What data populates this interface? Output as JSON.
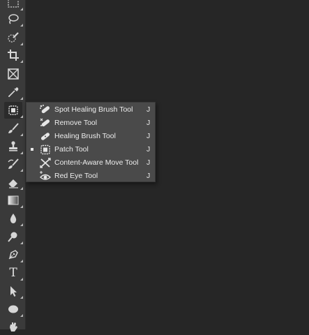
{
  "toolbar": {
    "tools": [
      {
        "name": "rectangular-marquee-tool",
        "icon": "marquee-icon"
      },
      {
        "name": "lasso-tool",
        "icon": "lasso-icon"
      },
      {
        "name": "quick-selection-tool",
        "icon": "quick-selection-icon"
      },
      {
        "name": "crop-tool",
        "icon": "crop-icon"
      },
      {
        "name": "frame-tool",
        "icon": "frame-icon"
      },
      {
        "name": "eyedropper-tool",
        "icon": "eyedropper-icon"
      },
      {
        "name": "patch-tool",
        "icon": "patch-icon",
        "active": true
      },
      {
        "name": "brush-tool",
        "icon": "brush-icon"
      },
      {
        "name": "clone-stamp-tool",
        "icon": "stamp-icon"
      },
      {
        "name": "history-brush-tool",
        "icon": "history-brush-icon"
      },
      {
        "name": "eraser-tool",
        "icon": "eraser-icon"
      },
      {
        "name": "gradient-tool",
        "icon": "gradient-icon"
      },
      {
        "name": "blur-tool",
        "icon": "blur-drop-icon"
      },
      {
        "name": "dodge-tool",
        "icon": "dodge-icon"
      },
      {
        "name": "pen-tool",
        "icon": "pen-icon"
      },
      {
        "name": "type-tool",
        "icon": "type-icon",
        "glyph": "T"
      },
      {
        "name": "path-selection-tool",
        "icon": "arrow-icon"
      },
      {
        "name": "ellipse-tool",
        "icon": "ellipse-icon"
      },
      {
        "name": "hand-tool",
        "icon": "hand-icon"
      }
    ]
  },
  "flyout": {
    "items": [
      {
        "label": "Spot Healing Brush Tool",
        "shortcut": "J",
        "icon": "spot-healing-brush-icon",
        "selected": false
      },
      {
        "label": "Remove Tool",
        "shortcut": "J",
        "icon": "remove-tool-icon",
        "selected": false
      },
      {
        "label": "Healing Brush Tool",
        "shortcut": "J",
        "icon": "healing-brush-icon",
        "selected": false
      },
      {
        "label": "Patch Tool",
        "shortcut": "J",
        "icon": "patch-icon",
        "selected": true
      },
      {
        "label": "Content-Aware Move Tool",
        "shortcut": "J",
        "icon": "content-aware-move-icon",
        "selected": false
      },
      {
        "label": "Red Eye Tool",
        "shortcut": "J",
        "icon": "red-eye-icon",
        "selected": false
      }
    ]
  },
  "colors": {
    "canvas": "#262626",
    "toolbar": "#3a3a3a",
    "flyout": "#4a4a4a",
    "text": "#ececec"
  }
}
